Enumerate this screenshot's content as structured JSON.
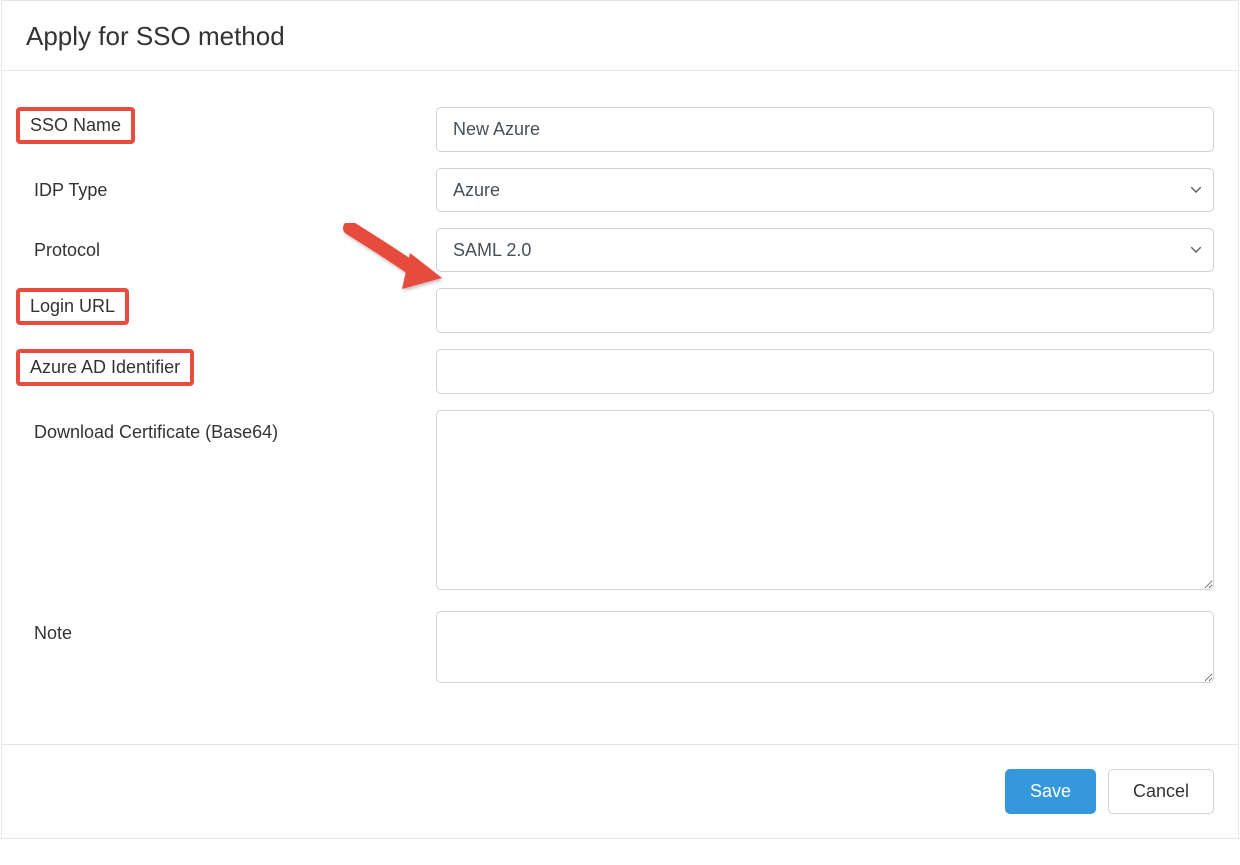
{
  "header": {
    "title": "Apply for SSO method"
  },
  "form": {
    "sso_name": {
      "label": "SSO Name",
      "value": "New Azure",
      "highlighted": true
    },
    "idp_type": {
      "label": "IDP Type",
      "value": "Azure",
      "highlighted": false
    },
    "protocol": {
      "label": "Protocol",
      "value": "SAML 2.0",
      "highlighted": false
    },
    "login_url": {
      "label": "Login URL",
      "value": "",
      "highlighted": true
    },
    "azure_ad_identifier": {
      "label": "Azure AD Identifier",
      "value": "",
      "highlighted": true
    },
    "certificate": {
      "label": "Download Certificate (Base64)",
      "value": "",
      "highlighted": false
    },
    "note": {
      "label": "Note",
      "value": "",
      "highlighted": false
    }
  },
  "footer": {
    "save_label": "Save",
    "cancel_label": "Cancel"
  },
  "annotations": {
    "arrow_points_to": "idp-type-select",
    "arrow_color": "#e74c3c"
  }
}
